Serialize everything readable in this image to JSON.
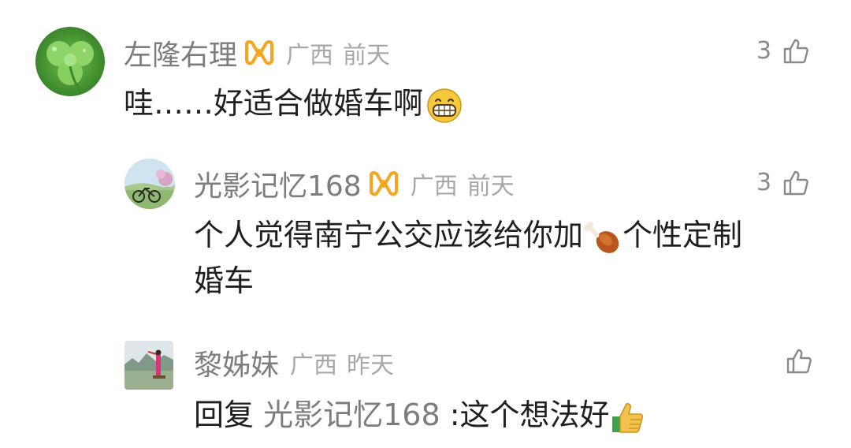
{
  "comments": [
    {
      "name": "左隆右理",
      "region": "广西",
      "time": "前天",
      "likes": "3",
      "text": "哇……好适合做婚车啊",
      "emoji": "grinning-face-icon"
    },
    {
      "name": "光影记忆168",
      "region": "广西",
      "time": "前天",
      "likes": "3",
      "text_line1": "个人觉得南宁公交应该给你加",
      "text_line1_after": "个性定制",
      "text_line2": "婚车",
      "emoji": "chicken-leg-icon"
    },
    {
      "name": "黎姊妹",
      "region": "广西",
      "time": "昨天",
      "likes": "",
      "reply_prefix": "回复",
      "reply_target": "光影记忆168",
      "reply_text": ":这个想法好",
      "emoji": "thumbs-up-icon"
    }
  ],
  "colors": {
    "badge": "#f7a51e",
    "name": "#7d7d7d",
    "meta": "#a8a8a8",
    "text": "#1f1f1f"
  }
}
